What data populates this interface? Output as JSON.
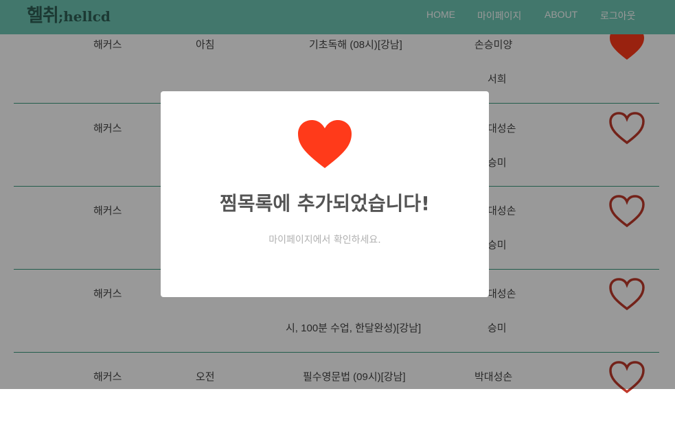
{
  "header": {
    "logo_main": "헬취",
    "logo_sub": ";hellcd",
    "nav": [
      {
        "label": "HOME"
      },
      {
        "label": "마이페이지"
      },
      {
        "label": "ABOUT"
      },
      {
        "label": "로그아웃"
      }
    ]
  },
  "courses": [
    {
      "academy": "해커스",
      "time": "아침",
      "title": "기초독해 (08시)[강남]",
      "teacher": "손승미양",
      "teacher_line2": "서희",
      "title_line2": "",
      "favorited": true
    },
    {
      "academy": "해커스",
      "time": "",
      "title": "",
      "teacher": "대성손",
      "teacher_line2": "승미",
      "title_line2": "",
      "favorited": false
    },
    {
      "academy": "해커스",
      "time": "",
      "title": "",
      "teacher": "대성손",
      "teacher_line2": "승미",
      "title_line2": "",
      "favorited": false
    },
    {
      "academy": "해커스",
      "time": "",
      "title": "",
      "teacher": "대성손",
      "teacher_line2": "승미",
      "title_line2": "시, 100분 수업, 한달완성)[강남]",
      "favorited": false
    },
    {
      "academy": "해커스",
      "time": "오전",
      "title": "필수영문법 (09시)[강남]",
      "teacher": "박대성손",
      "teacher_line2": "",
      "title_line2": "",
      "favorited": false
    }
  ],
  "modal": {
    "icon": "heart-icon",
    "title": "찜목록에 추가되었습니다!",
    "subtitle": "마이페이지에서 확인하세요."
  },
  "colors": {
    "header_bg": "#6fc7b5",
    "heart_red": "#ff3a1a",
    "heart_outline": "#c0392b",
    "divider": "#3a9c7f"
  }
}
